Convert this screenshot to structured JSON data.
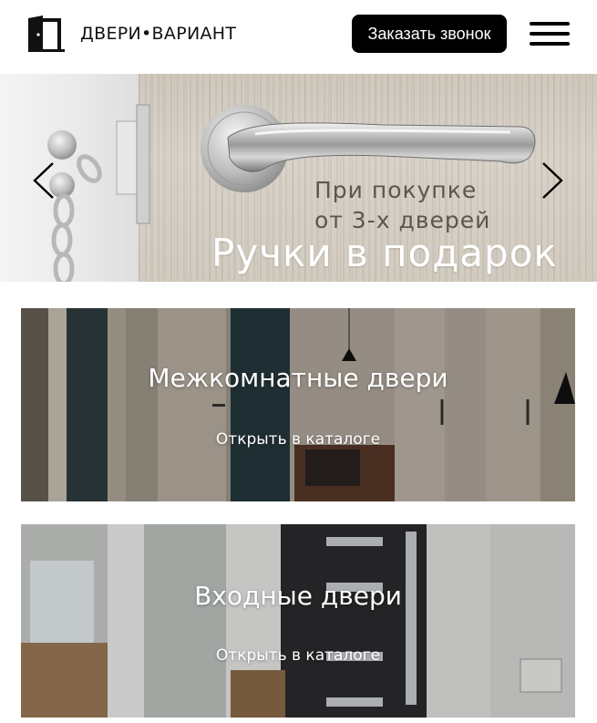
{
  "header": {
    "logo_text": "ДВЕРИ•ВАРИАНТ",
    "call_button": "Заказать звонок"
  },
  "slider": {
    "promo_line1": "При покупке",
    "promo_line2": "от 3-х дверей",
    "promo_big": "Ручки в подарок"
  },
  "categories": [
    {
      "title": "Межкомнатные двери",
      "link": "Открыть в каталоге"
    },
    {
      "title": "Входные двери",
      "link": "Открыть в каталоге"
    }
  ],
  "icons": [
    "door-logo-icon",
    "menu-icon",
    "arrow-left-icon",
    "arrow-right-icon"
  ],
  "colors": {
    "primary": "#000000",
    "background": "#ffffff",
    "text_on_image": "#ffffff"
  }
}
